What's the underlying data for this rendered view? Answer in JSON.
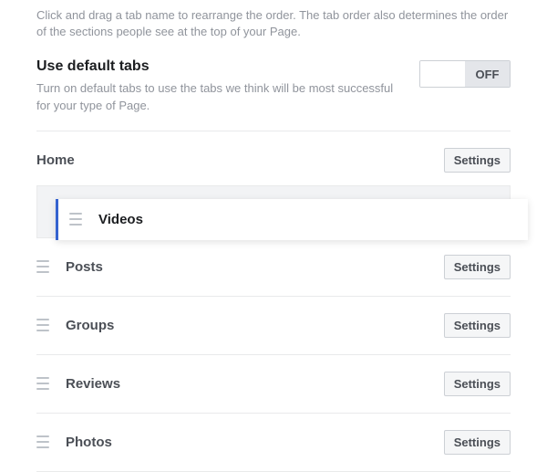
{
  "intro": "Click and drag a tab name to rearrange the order. The tab order also determines the order of the sections people see at the top of your Page.",
  "defaultTabs": {
    "title": "Use default tabs",
    "description": "Turn on default tabs to use the tabs we think will be most successful for your type of Page.",
    "offLabel": "OFF"
  },
  "home": {
    "label": "Home",
    "settings": "Settings"
  },
  "draggedItem": {
    "label": "Videos"
  },
  "tabs": [
    {
      "label": "Posts",
      "settings": "Settings"
    },
    {
      "label": "Groups",
      "settings": "Settings"
    },
    {
      "label": "Reviews",
      "settings": "Settings"
    },
    {
      "label": "Photos",
      "settings": "Settings"
    }
  ]
}
